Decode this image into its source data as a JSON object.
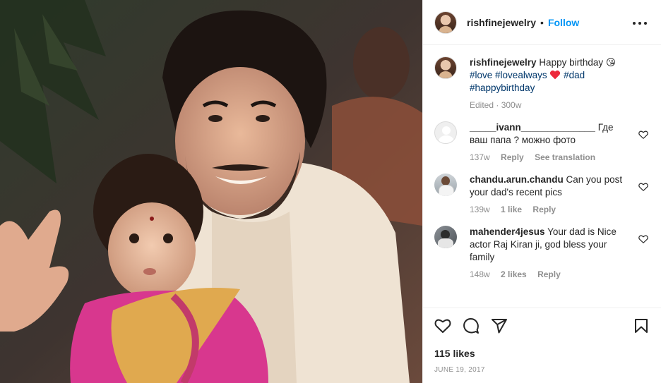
{
  "header": {
    "username": "rishfinejewelry",
    "separator": "•",
    "follow_label": "Follow"
  },
  "caption": {
    "username": "rishfinejewelry",
    "text_start": "Happy birthday",
    "emoji_kiss": "😘",
    "hashtag_love": "#love",
    "hashtag_lovealways": "#lovealways",
    "hashtag_dad": "#dad",
    "hashtag_happybirthday": "#happybirthday",
    "meta": "Edited · 300w"
  },
  "comments": [
    {
      "username": "_____ivann______________",
      "text": "Где ваш папа ? можно фото",
      "age": "137w",
      "reply_label": "Reply",
      "translate_label": "See translation"
    },
    {
      "username": "chandu.arun.chandu",
      "text": "Can you post your dad's recent pics",
      "age": "139w",
      "likes_label": "1 like",
      "reply_label": "Reply"
    },
    {
      "username": "mahender4jesus",
      "text": "Your dad is Nice actor Raj Kiran ji, god bless your family",
      "age": "148w",
      "likes_label": "2 likes",
      "reply_label": "Reply"
    }
  ],
  "footer": {
    "likes": "115 likes",
    "date": "JUNE 19, 2017"
  },
  "icons": {
    "like": "heart-outline-icon",
    "comment": "speech-bubble-icon",
    "share": "paper-plane-icon",
    "save": "bookmark-icon",
    "more": "ellipsis-icon",
    "red_heart": "red-heart-emoji"
  },
  "colors": {
    "accent": "#0095f6",
    "hashtag": "#00376b",
    "muted": "#8e8e8e",
    "text": "#262626",
    "heart_emoji": "#ed2a3c"
  }
}
